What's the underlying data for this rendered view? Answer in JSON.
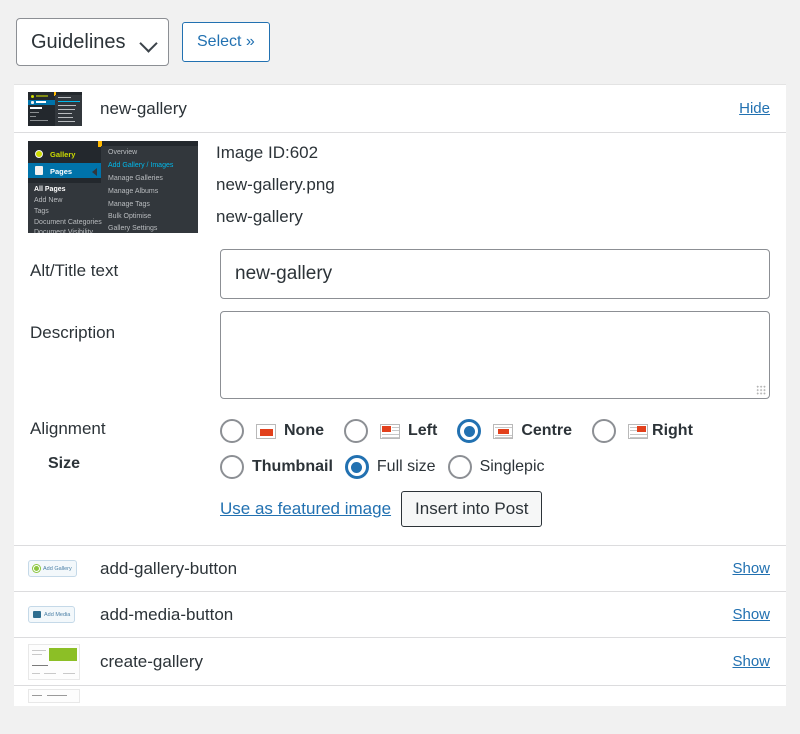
{
  "toolbar": {
    "dropdown_value": "Guidelines",
    "dropdown_options": [
      "Guidelines"
    ],
    "select_button_label": "Select »"
  },
  "header_row": {
    "name": "new-gallery",
    "action_label": "Hide",
    "thumb_icon": "wordpress-admin-menu-screenshot"
  },
  "detail": {
    "image_id": "Image ID:602",
    "file_name": "new-gallery.png",
    "title": "new-gallery",
    "fields": {
      "alt_label": "Alt/Title text",
      "alt_value": "new-gallery",
      "alt_placeholder": "",
      "description_label": "Description",
      "description_value": "",
      "description_placeholder": "",
      "alignment_label": "Alignment",
      "size_label": "Size"
    },
    "alignment_options": [
      {
        "label": "None",
        "icon": "align-none-icon",
        "selected": false
      },
      {
        "label": "Left",
        "icon": "align-left-icon",
        "selected": false
      },
      {
        "label": "Centre",
        "icon": "align-centre-icon",
        "selected": true
      },
      {
        "label": "Right",
        "icon": "align-right-icon",
        "selected": false
      }
    ],
    "size_options": [
      {
        "label": "Thumbnail",
        "selected": false
      },
      {
        "label": "Full size",
        "selected": true
      },
      {
        "label": "Singlepic",
        "selected": false
      }
    ],
    "featured_link_label": "Use as featured image",
    "insert_button_label": "Insert into Post"
  },
  "list": [
    {
      "name": "add-gallery-button",
      "action_label": "Show",
      "thumb": "add-gallery-button-icon",
      "thumb_text": "Add Gallery"
    },
    {
      "name": "add-media-button",
      "action_label": "Show",
      "thumb": "add-media-button-icon",
      "thumb_text": "Add Media"
    },
    {
      "name": "create-gallery",
      "action_label": "Show",
      "thumb": "create-gallery-screenshot",
      "thumb_text": ""
    }
  ],
  "wp_menu_thumb": {
    "items_left": [
      "Gallery",
      "Pages",
      "All Pages",
      "Add New",
      "Tags",
      "Document Categories",
      "Document Visibility"
    ],
    "items_flyout": [
      "Overview",
      "Add Gallery / Images",
      "Manage Galleries",
      "Manage Albums",
      "Manage Tags",
      "Bulk Optimise",
      "Gallery Settings"
    ],
    "selected_left": "Pages",
    "highlighted_flyout": "Add Gallery / Images"
  },
  "colors": {
    "accent_blue": "#2271b1",
    "wp_blue": "#0073aa",
    "wp_dark": "#23282d",
    "wp_flyout": "#32373c",
    "highlight_cyan": "#00b9eb",
    "orange": "#e2401c",
    "green": "#8cc63f",
    "page_bg": "#f1f1f1"
  }
}
